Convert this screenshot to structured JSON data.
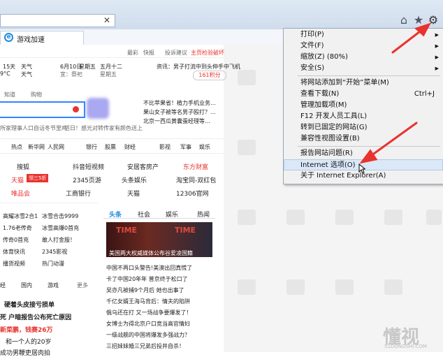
{
  "tab": {
    "title": "游戏加速"
  },
  "toolbar": {
    "home": "home-icon",
    "favorites": "star-icon",
    "tools": "gear-icon"
  },
  "header_links": [
    "最彩",
    "快报",
    "投诉建议",
    "主页检验破坏"
  ],
  "info": {
    "weather": [
      "15天",
      "天气",
      "9°C"
    ],
    "date": [
      "6月10日",
      "星期五",
      "宜：祭祀"
    ],
    "lunar": [
      "五月十二",
      "星期五"
    ],
    "news_top": "资讯：男子打流中到头伸手中飞机",
    "score": "161积分"
  },
  "search": {
    "radio1": "知道",
    "radio2": "购物",
    "tip1": "所家理事人口自话冬节里鸡",
    "tip2": "活日！感光对转传家有颜色送上",
    "right_news": [
      "不比苹果省！植力手机业务…",
      "果山女子被等名男子殴打？…",
      "北京一西瓜黄囊蛋经理等…"
    ]
  },
  "nav": [
    "热点",
    "新华网",
    "人民网",
    "银行",
    "股票",
    "财经",
    "影视",
    "军事",
    "娱乐"
  ],
  "sites": [
    [
      "搜狐",
      "抖音短视频",
      "安居客房产",
      "东方财富"
    ],
    [
      "天猫",
      "2345页游",
      "头条娱乐",
      "淘宝同-双红包"
    ],
    [
      "唯品会",
      "工商银行",
      "天猫",
      "12306官网"
    ]
  ],
  "tmall_badge": "领三5折",
  "left_list": [
    [
      "高耀冰雪2合1",
      "冰雪合击9999"
    ],
    [
      "1.76老传奇",
      "冰雪高爆0首充"
    ],
    [
      "传奇0首充",
      "敢人打金服！"
    ],
    [
      "体育快讯",
      "2345影视"
    ],
    [
      "播货视频",
      "热门动漫"
    ]
  ],
  "news_tabs": [
    "头条",
    "社会",
    "娱乐",
    "热闻"
  ],
  "news_image_caption": "美国两大权威媒体公布谷爱凌国籍",
  "news_image_tag": "TIME",
  "news": [
    "中国不再口头警告!美澳出回真慌了",
    "卡了中国20年年 普京终于松口了",
    "吴亦凡被捕9个月后 她也出事了",
    "千亿女婿王海马背后：情夫的陷阱",
    "俄乌还在打 又一场战争要爆发了！",
    "女博士为得北京户口竞当高官情妇",
    "一级战舰的中国将爆发多强战力？",
    "三招妹妹婚三兄弟后投井自杀！"
  ],
  "left_tabs": [
    "经",
    "国内",
    "游戏",
    "更多"
  ],
  "left_news": [
    "硬着头皮接亏损单",
    "死 户暗报告公布死亡原因",
    "新菜鹏，钱赛26万",
    "和一个人的20岁",
    "成功男鞭吏居肉拍"
  ],
  "menu": {
    "items": [
      {
        "label": "打印(P)",
        "arrow": true
      },
      {
        "label": "文件(F)",
        "arrow": true
      },
      {
        "label": "缩放(Z) (80%)",
        "arrow": true
      },
      {
        "label": "安全(S)",
        "arrow": true
      },
      {
        "label": "将网站添加到“开始”菜单(M)"
      },
      {
        "label": "查看下载(N)",
        "shortcut": "Ctrl+J"
      },
      {
        "label": "管理加载项(M)"
      },
      {
        "label": "F12 开发人员工具(L)"
      },
      {
        "label": "转到已固定的网站(G)"
      },
      {
        "label": "兼容性视图设置(B)"
      },
      {
        "label": "报告网站问题(R)"
      },
      {
        "label": "Internet 选项(O)"
      },
      {
        "label": "关于 Internet Explorer(A)"
      }
    ]
  },
  "watermark": "S1DONGSHI.COM",
  "watermark_big": "懂视",
  "colors": {
    "accent": "#1e8be0",
    "red": "#e8332f",
    "arrow": "#e8332f"
  }
}
